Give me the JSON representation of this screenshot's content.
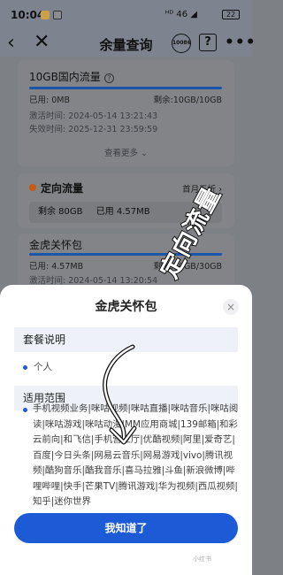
{
  "status": {
    "time": "10:04",
    "signal": "ᴴᴰ 46 ◢",
    "battery": "22"
  },
  "nav": {
    "title": "余量查询",
    "service_badge": "10086",
    "help_icon": "question-box-icon"
  },
  "background": {
    "card1": {
      "name": "10GB国内流量",
      "used": "已用: 0MB",
      "remaining": "剩余:10GB/10GB",
      "activated": "激活时间: 2024-05-14 13:21:43",
      "expires": "失效时间: 2025-12-31 23:59:59",
      "see_more": "查看更多 ⌄"
    },
    "card2": {
      "name": "定向流量",
      "promo": "首月五折 ›",
      "remaining": "剩余 80GB",
      "used": "已用 4.57MB"
    },
    "card3": {
      "name": "金虎关怀包",
      "used": "已用: 4.57MB",
      "remaining": "剩余:30GB/30GB",
      "activated": "激活时间: 2024-05-14 13:20:54"
    }
  },
  "sheet": {
    "title": "金虎关怀包",
    "close_label": "×",
    "section1_title": "套餐说明",
    "section1_items": [
      "个人"
    ],
    "section2_title": "适用范围",
    "scope_text": "手机视频业务|咪咕视频|咪咕直播|咪咕音乐|咪咕阅读|咪咕游戏|咪咕动漫|MM应用商城|139邮箱|和彩云前向|和飞信|手机营业厅|优酷视频|阿里|爱奇艺|百度|今日头条|网易云音乐|网易游戏|vivo|腾讯视频|酷狗音乐|酷我音乐|喜马拉雅|斗鱼|新浪微博|哔哩哔哩|快手|芒果TV|腾讯游戏|华为视频|西瓜视频|知乎|迷你世界",
    "ok_button": "我知道了",
    "watermark": "小红书"
  },
  "overlay": {
    "handwritten_label": "定向流量"
  }
}
